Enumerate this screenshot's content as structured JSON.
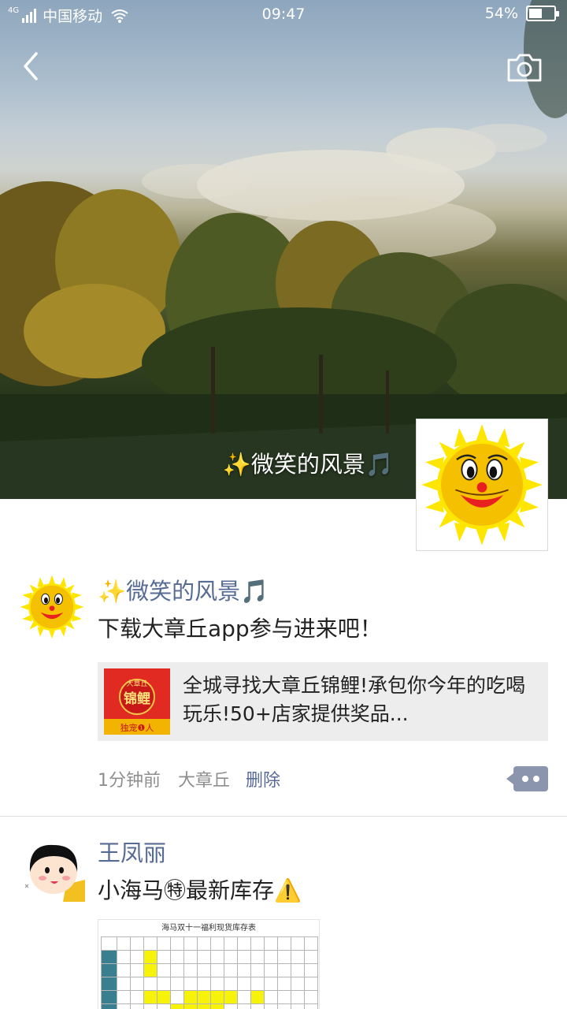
{
  "status_bar": {
    "network": "4G",
    "carrier": "中国移动",
    "time": "09:47",
    "battery_percent": "54%",
    "battery_level": 0.54
  },
  "cover": {
    "display_name": "✨微笑的风景🎵",
    "icons": {
      "back": "back-arrow-icon",
      "camera": "camera-icon"
    }
  },
  "posts": [
    {
      "author": "✨微笑的风景🎵",
      "text": "下载大章丘app参与进来吧！",
      "link": {
        "title": "全城寻找大章丘锦鲤!承包你今年的吃喝玩乐!50+店家提供奖品...",
        "thumb_top": "大章丘",
        "thumb_main": "锦鲤",
        "thumb_bottom": "独宠❶人"
      },
      "time": "1分钟前",
      "source": "大章丘",
      "delete_label": "删除"
    },
    {
      "author": "王凤丽",
      "text": "小海马㊕最新库存⚠️",
      "sheet_title": "海马双十一福利现货库存表"
    }
  ],
  "colors": {
    "link_blue": "#576b95",
    "meta_gray": "#8e8e8e",
    "card_bg": "#ededed",
    "comment_button": "#8b95ad"
  }
}
